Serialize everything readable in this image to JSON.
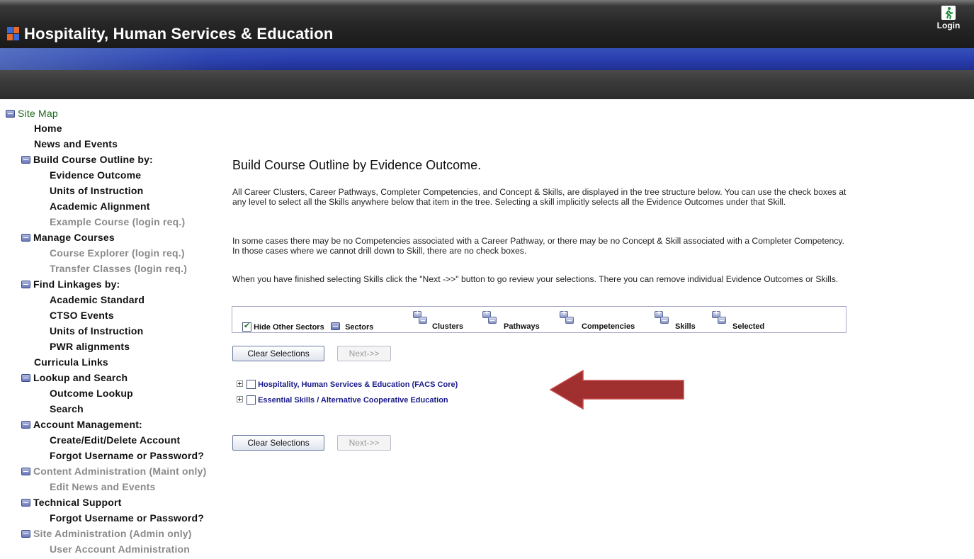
{
  "header": {
    "title": "Hospitality, Human Services & Education",
    "login_label": "Login"
  },
  "sidebar": {
    "root": "Site Map",
    "items": [
      {
        "label": "Home",
        "level": 1,
        "state": "normal"
      },
      {
        "label": "News and Events",
        "level": 1,
        "state": "normal"
      },
      {
        "label": "Build Course Outline by:",
        "level": 1,
        "state": "group"
      },
      {
        "label": "Evidence Outcome",
        "level": 2,
        "state": "normal"
      },
      {
        "label": "Units of Instruction",
        "level": 2,
        "state": "normal"
      },
      {
        "label": "Academic Alignment",
        "level": 2,
        "state": "normal"
      },
      {
        "label": "Example Course (login req.)",
        "level": 2,
        "state": "disabled"
      },
      {
        "label": "Manage Courses",
        "level": 1,
        "state": "group"
      },
      {
        "label": "Course Explorer (login req.)",
        "level": 2,
        "state": "disabled"
      },
      {
        "label": "Transfer Classes (login req.)",
        "level": 2,
        "state": "disabled"
      },
      {
        "label": "Find Linkages by:",
        "level": 1,
        "state": "group"
      },
      {
        "label": "Academic Standard",
        "level": 2,
        "state": "normal"
      },
      {
        "label": "CTSO Events",
        "level": 2,
        "state": "normal"
      },
      {
        "label": "Units of Instruction",
        "level": 2,
        "state": "normal"
      },
      {
        "label": "PWR alignments",
        "level": 2,
        "state": "normal"
      },
      {
        "label": "Curricula Links",
        "level": 1,
        "state": "normal"
      },
      {
        "label": "Lookup and Search",
        "level": 1,
        "state": "group"
      },
      {
        "label": "Outcome Lookup",
        "level": 2,
        "state": "normal"
      },
      {
        "label": "Search",
        "level": 2,
        "state": "normal"
      },
      {
        "label": "Account Management:",
        "level": 1,
        "state": "group"
      },
      {
        "label": "Create/Edit/Delete Account",
        "level": 2,
        "state": "normal"
      },
      {
        "label": "Forgot Username or Password?",
        "level": 2,
        "state": "normal"
      },
      {
        "label": "Content Administration (Maint only)",
        "level": 1,
        "state": "group-disabled"
      },
      {
        "label": "Edit News and Events",
        "level": 2,
        "state": "disabled"
      },
      {
        "label": "Technical Support",
        "level": 1,
        "state": "group"
      },
      {
        "label": "Forgot Username or Password?",
        "level": 2,
        "state": "normal"
      },
      {
        "label": "Site Administration (Admin only)",
        "level": 1,
        "state": "group-disabled"
      },
      {
        "label": "User Account Administration",
        "level": 2,
        "state": "disabled"
      }
    ]
  },
  "main": {
    "title": "Build Course Outline by Evidence Outcome.",
    "paragraphs": [
      "All Career Clusters, Career Pathways, Completer Competencies, and Concept & Skills, are displayed in the tree structure below. You can use the check boxes at any level to select all the Skills anywhere below that item in the tree. Selecting a skill implicitly selects all the Evidence Outcomes under that Skill.",
      "In some cases there may be no Competencies associated with a Career Pathway, or there may be no Concept & Skill associated with a Completer Competency. In those cases where we cannot drill down to Skill, there are no check boxes.",
      "When you have finished selecting Skills click the \"Next ->>\" button to go review your selections. There you can remove individual Evidence Outcomes or Skills."
    ],
    "legend": {
      "hide_other_sectors": "Hide Other Sectors",
      "hide_other_sectors_checked": true,
      "sectors": "Sectors",
      "clusters": "Clusters",
      "pathways": "Pathways",
      "competencies": "Competencies",
      "skills": "Skills",
      "selected": "Selected"
    },
    "buttons": {
      "clear": "Clear Selections",
      "next": "Next->>"
    },
    "tree": [
      "Hospitality, Human Services & Education (FACS Core)",
      "Essential Skills / Alternative Cooperative Education"
    ],
    "arrow_color": "#a03030"
  }
}
